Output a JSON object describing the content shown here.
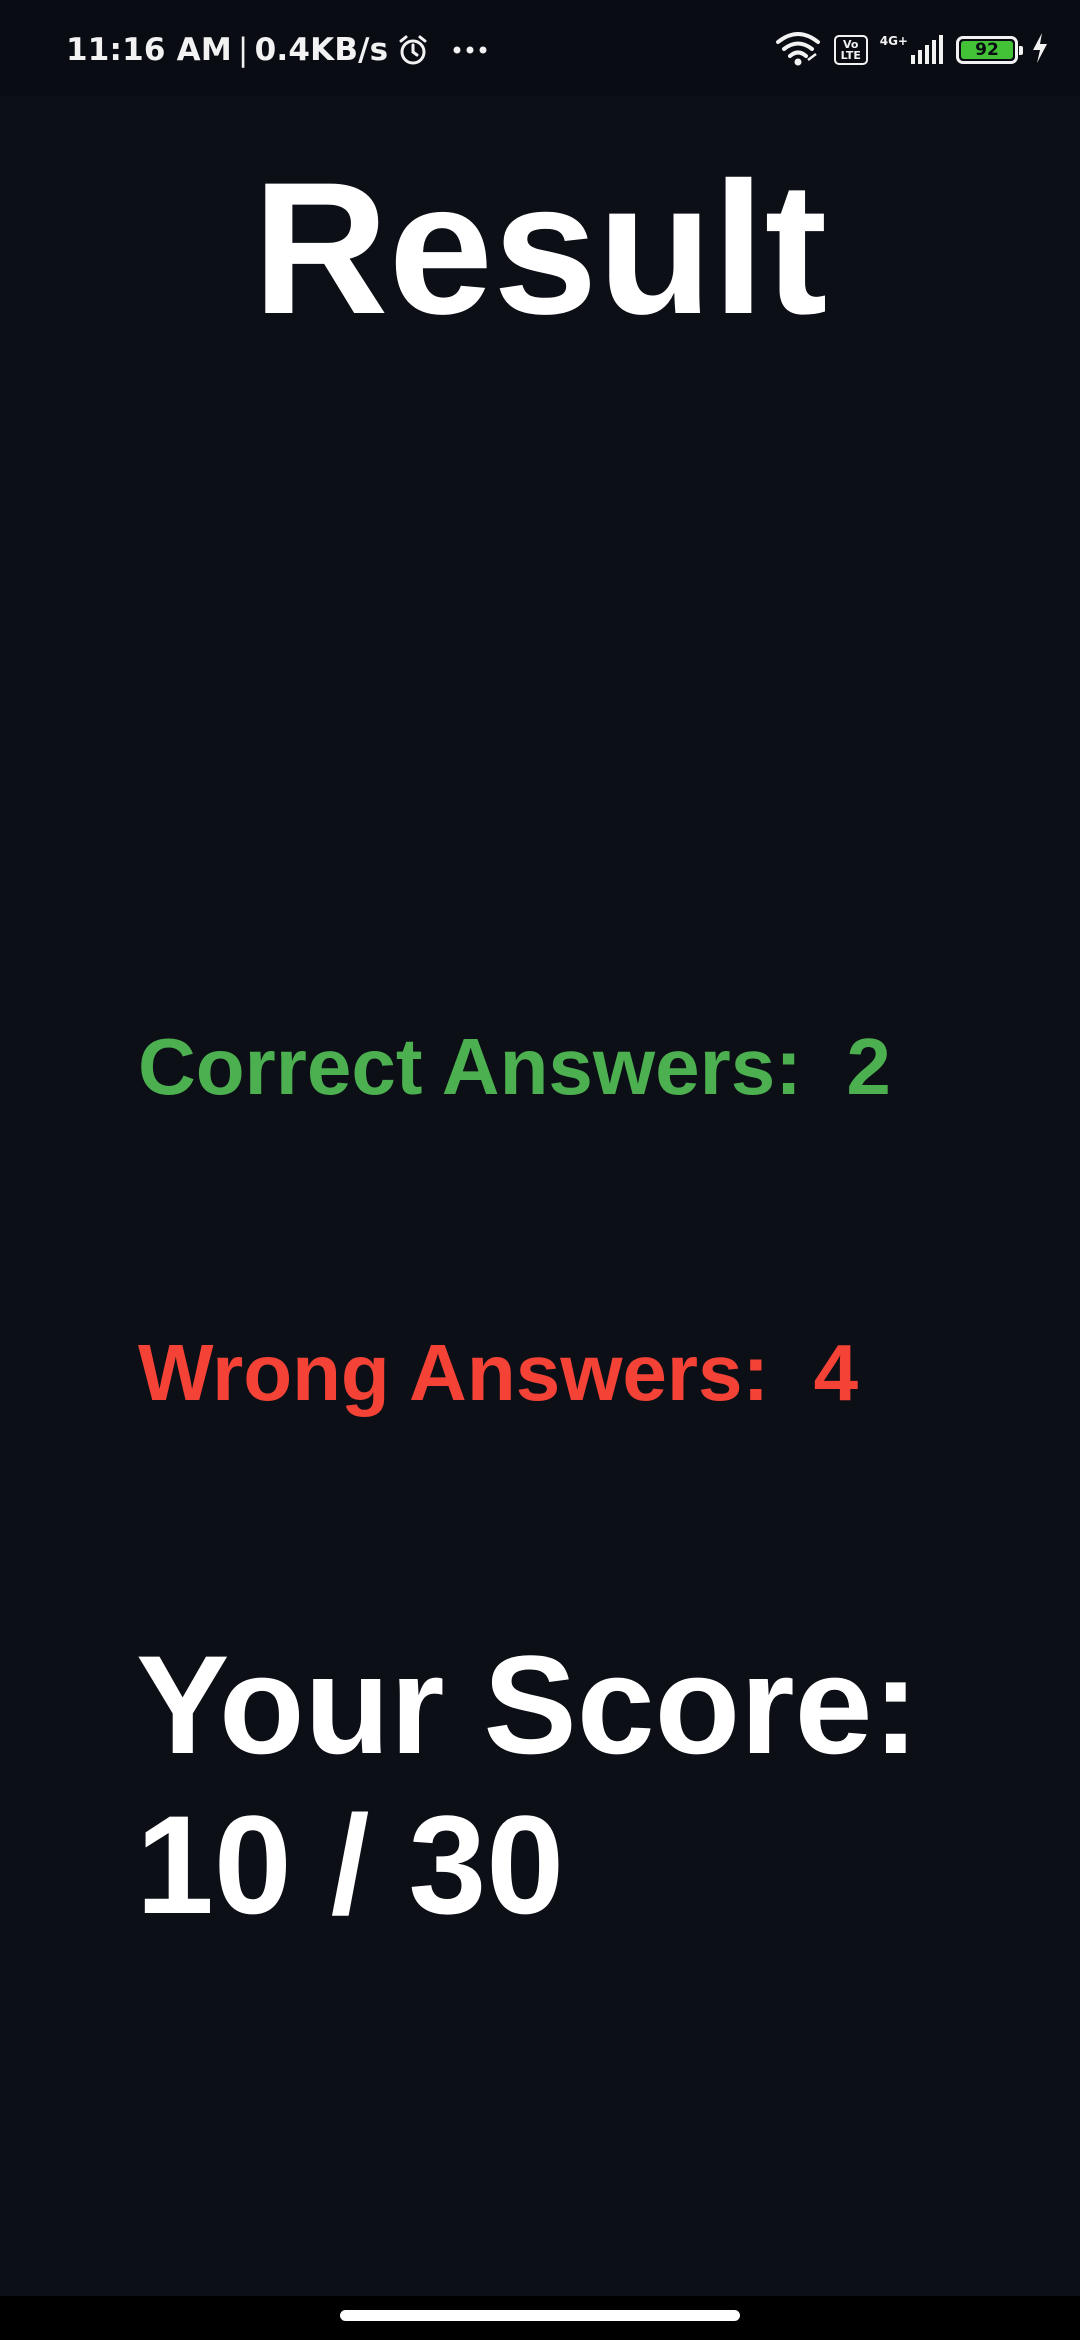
{
  "status_bar": {
    "time": "11:16 AM",
    "separator": "|",
    "network_speed": "0.4KB/s",
    "volte_top": "Vo",
    "volte_bottom": "LTE",
    "network_type": "4G+",
    "battery_level": "92",
    "battery_color": "#43c238",
    "icons": [
      "alarm-icon",
      "more-dots-icon",
      "wifi-icon",
      "volte-icon",
      "signal-icon",
      "battery-icon",
      "charging-icon"
    ]
  },
  "result": {
    "title": "Result",
    "correct_text": "Correct Answers:  2",
    "wrong_text": "Wrong Answers:  4",
    "score_label": "Your Score:",
    "score_value": "10 / 30"
  },
  "colors": {
    "background": "#0d0f17",
    "correct": "#4caf50",
    "wrong": "#f44336",
    "text": "#ffffff"
  }
}
